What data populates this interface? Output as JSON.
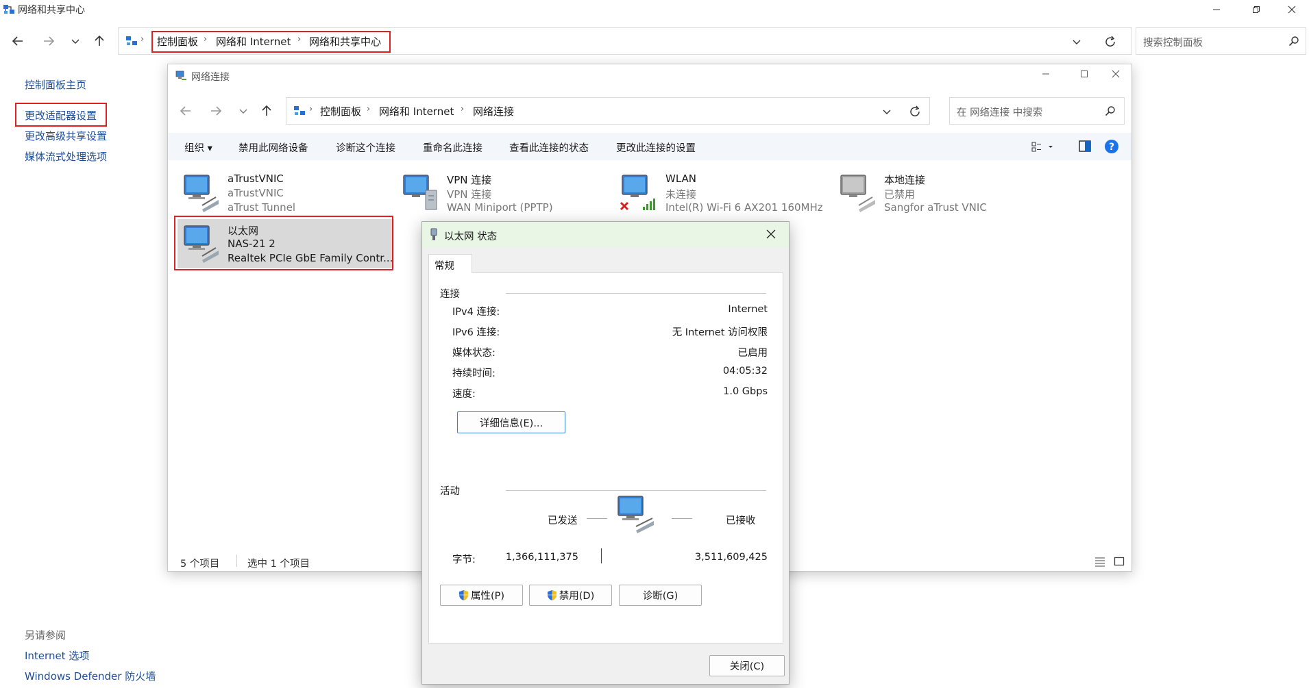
{
  "main_window": {
    "title": "网络和共享中心",
    "breadcrumb": [
      "控制面板",
      "网络和 Internet",
      "网络和共享中心"
    ],
    "search_placeholder": "搜索控制面板",
    "sidebar": {
      "home": "控制面板主页",
      "links": [
        "更改适配器设置",
        "更改高级共享设置",
        "媒体流式处理选项"
      ],
      "see_also_heading": "另请参阅",
      "see_also": [
        "Internet 选项",
        "Windows Defender 防火墙"
      ]
    }
  },
  "net_window": {
    "title": "网络连接",
    "breadcrumb": [
      "控制面板",
      "网络和 Internet",
      "网络连接"
    ],
    "search_placeholder": "在 网络连接 中搜索",
    "toolbar": [
      "组织 ▾",
      "禁用此网络设备",
      "诊断这个连接",
      "重命名此连接",
      "查看此连接的状态",
      "更改此连接的设置"
    ],
    "items": [
      {
        "name": "aTrustVNIC",
        "status": "aTrustVNIC",
        "device": "aTrust Tunnel"
      },
      {
        "name": "VPN 连接",
        "status": "VPN 连接",
        "device": "WAN Miniport (PPTP)"
      },
      {
        "name": "WLAN",
        "status": "未连接",
        "device": "Intel(R) Wi-Fi 6 AX201 160MHz"
      },
      {
        "name": "本地连接",
        "status": "已禁用",
        "device": "Sangfor aTrust VNIC"
      },
      {
        "name": "以太网",
        "status": "NAS-21 2",
        "device": "Realtek PCIe GbE Family Contr..."
      }
    ],
    "status_count": "5 个项目",
    "status_selected": "选中 1 个项目"
  },
  "dialog": {
    "title": "以太网 状态",
    "tab": "常规",
    "connection_heading": "连接",
    "rows": [
      {
        "label": "IPv4 连接:",
        "value": "Internet"
      },
      {
        "label": "IPv6 连接:",
        "value": "无 Internet 访问权限"
      },
      {
        "label": "媒体状态:",
        "value": "已启用"
      },
      {
        "label": "持续时间:",
        "value": "04:05:32"
      },
      {
        "label": "速度:",
        "value": "1.0 Gbps"
      }
    ],
    "details_button": "详细信息(E)...",
    "activity_heading": "活动",
    "sent_label": "已发送",
    "received_label": "已接收",
    "bytes_label": "字节:",
    "bytes_sent": "1,366,111,375",
    "bytes_received": "3,511,609,425",
    "properties_button": "属性(P)",
    "disable_button": "禁用(D)",
    "diagnose_button": "诊断(G)",
    "close_button": "关闭(C)"
  },
  "colors": {
    "link": "#1f4e99",
    "highlight": "#e02020",
    "toolbar_bg": "#f3f6fb",
    "dialog_title_bg": "#e9f6e6",
    "selected_item_bg": "#d9d9d9"
  }
}
